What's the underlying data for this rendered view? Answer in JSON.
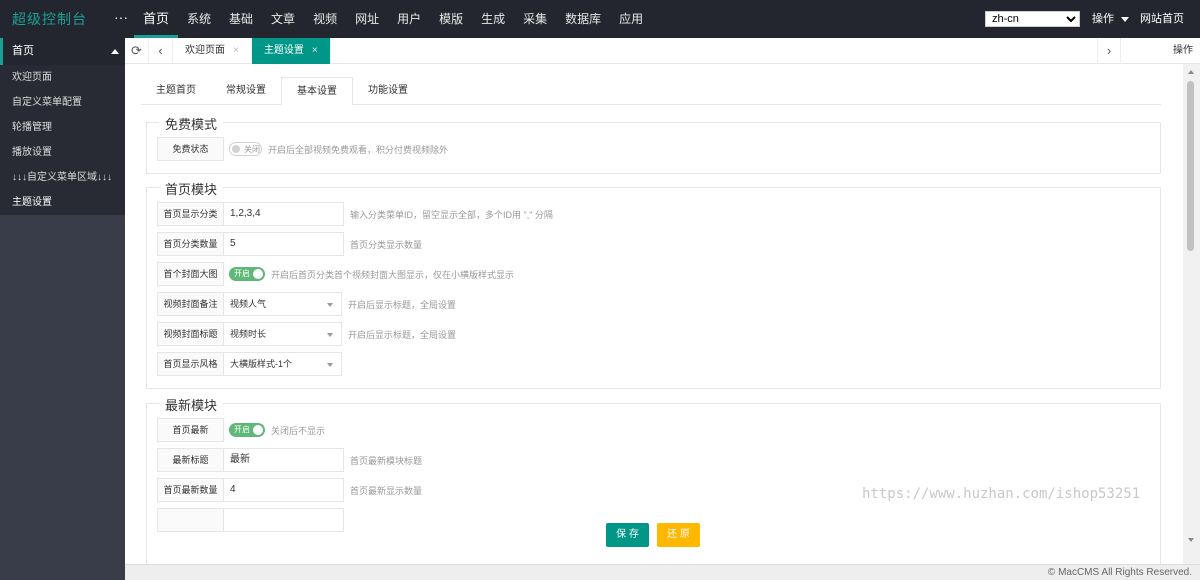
{
  "header": {
    "logo": "超级控制台",
    "more": "···",
    "nav": [
      "首页",
      "系统",
      "基础",
      "文章",
      "视频",
      "网址",
      "用户",
      "模版",
      "生成",
      "采集",
      "数据库",
      "应用"
    ],
    "language": "zh-cn",
    "operate": "操作",
    "site_home": "网站首页"
  },
  "sidebar": {
    "group": "首页",
    "items": [
      "欢迎页面",
      "自定义菜单配置",
      "轮播管理",
      "播放设置",
      "↓↓↓自定义菜单区域↓↓↓",
      "主题设置"
    ]
  },
  "tabbar": {
    "refresh_icon": "⟳",
    "prev_icon": "‹",
    "next_icon": "›",
    "tabs": [
      {
        "label": "欢迎页面",
        "close": "×"
      },
      {
        "label": "主题设置",
        "close": "×"
      }
    ],
    "operate": "操作"
  },
  "subtabs": [
    "主题首页",
    "常规设置",
    "基本设置",
    "功能设置"
  ],
  "free_mode": {
    "title": "免费模式",
    "status_label": "免费状态",
    "status_switch": "关闭",
    "status_hint": "开启后全部视频免费观看，积分付费视频除外"
  },
  "home_module": {
    "title": "首页模块",
    "rows": [
      {
        "label": "首页显示分类",
        "value": "1,2,3,4",
        "hint": "输入分类菜单ID，留空显示全部，多个ID用 \",\" 分隔"
      },
      {
        "label": "首页分类数量",
        "value": "5",
        "hint": "首页分类显示数量"
      },
      {
        "label": "首个封面大图",
        "switch": "开启",
        "hint": "开启后首页分类首个视频封面大图显示，仅在小横版样式显示"
      },
      {
        "label": "视频封面备注",
        "value": "视频人气",
        "hint": "开启后显示标题，全局设置"
      },
      {
        "label": "视频封面标题",
        "value": "视频时长",
        "hint": "开启后显示标题，全局设置"
      },
      {
        "label": "首页显示风格",
        "value": "大横版样式-1个"
      }
    ]
  },
  "latest_module": {
    "title": "最新模块",
    "rows": [
      {
        "label": "首页最新",
        "switch": "开启",
        "hint": "关闭后不显示"
      },
      {
        "label": "最新标题",
        "value": "最新",
        "hint": "首页最新模块标题"
      },
      {
        "label": "首页最新数量",
        "value": "4",
        "hint": "首页最新显示数量"
      }
    ]
  },
  "buttons": {
    "save": "保 存",
    "reset": "还 原"
  },
  "watermark": "https://www.huzhan.com/ishop53251",
  "footer": {
    "copyright": "© MacCMS All Rights Reserved."
  },
  "colors": {
    "accent": "#009688",
    "header_bg": "#23262e",
    "sidebar_bg": "#393d49",
    "switch_on": "#5fb878",
    "reset_btn": "#ffb800"
  }
}
